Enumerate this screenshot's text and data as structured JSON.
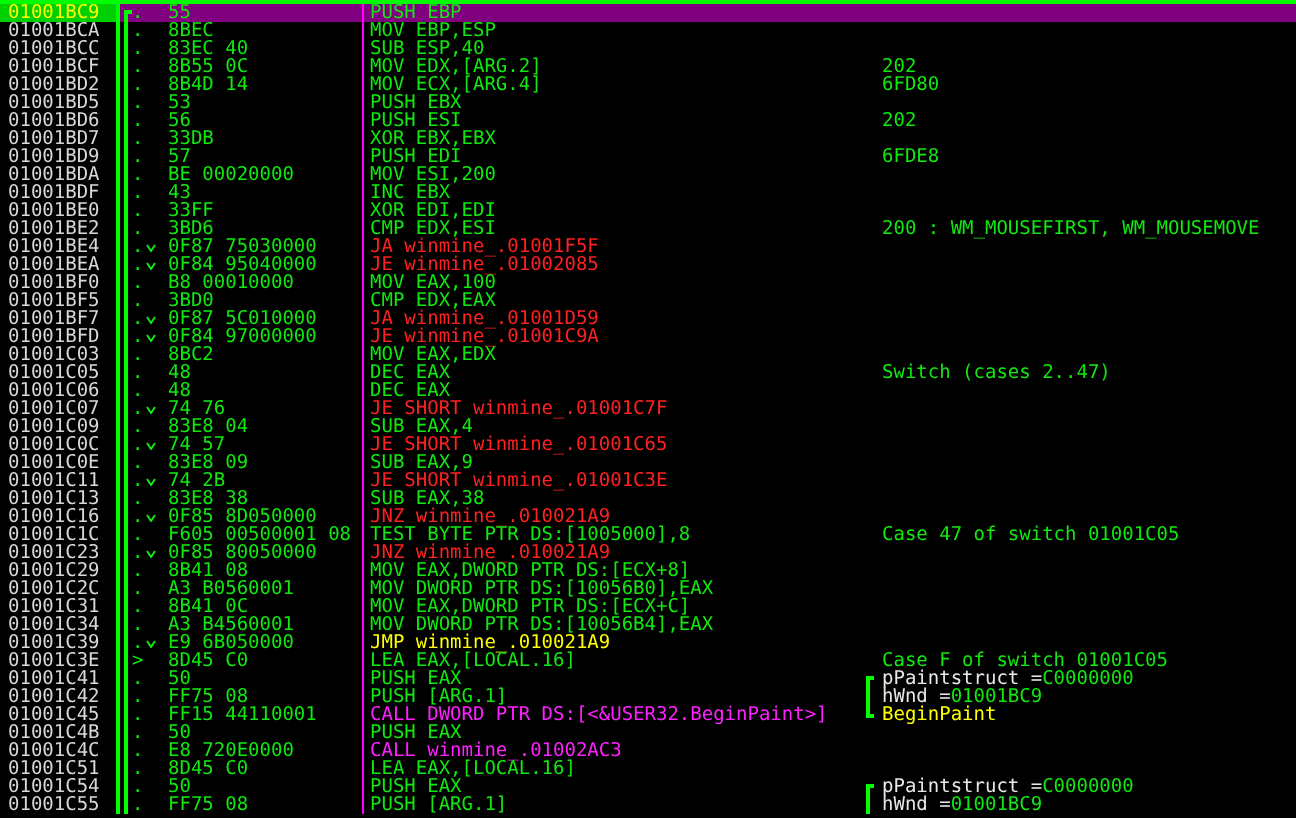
{
  "rows": [
    {
      "address": "01001BC9",
      "marker": ".",
      "jump": false,
      "hex": "55",
      "instruction": "PUSH EBP",
      "kind": "plain",
      "selected": true
    },
    {
      "address": "01001BCA",
      "marker": ".",
      "jump": false,
      "hex": "8BEC",
      "instruction": "MOV EBP,ESP",
      "kind": "plain",
      "selected": false
    },
    {
      "address": "01001BCC",
      "marker": ".",
      "jump": false,
      "hex": "83EC 40",
      "instruction": "SUB ESP,40",
      "kind": "plain",
      "selected": false
    },
    {
      "address": "01001BCF",
      "marker": ".",
      "jump": false,
      "hex": "8B55 0C",
      "instruction": "MOV EDX,[ARG.2]",
      "kind": "plain",
      "selected": false,
      "comment": {
        "kind": "note",
        "text": "202"
      }
    },
    {
      "address": "01001BD2",
      "marker": ".",
      "jump": false,
      "hex": "8B4D 14",
      "instruction": "MOV ECX,[ARG.4]",
      "kind": "plain",
      "selected": false,
      "comment": {
        "kind": "note",
        "text": "6FD80"
      }
    },
    {
      "address": "01001BD5",
      "marker": ".",
      "jump": false,
      "hex": "53",
      "instruction": "PUSH EBX",
      "kind": "plain",
      "selected": false
    },
    {
      "address": "01001BD6",
      "marker": ".",
      "jump": false,
      "hex": "56",
      "instruction": "PUSH ESI",
      "kind": "plain",
      "selected": false,
      "comment": {
        "kind": "note",
        "text": "202"
      }
    },
    {
      "address": "01001BD7",
      "marker": ".",
      "jump": false,
      "hex": "33DB",
      "instruction": "XOR EBX,EBX",
      "kind": "plain",
      "selected": false
    },
    {
      "address": "01001BD9",
      "marker": ".",
      "jump": false,
      "hex": "57",
      "instruction": "PUSH EDI",
      "kind": "plain",
      "selected": false,
      "comment": {
        "kind": "note",
        "text": "6FDE8"
      }
    },
    {
      "address": "01001BDA",
      "marker": ".",
      "jump": false,
      "hex": "BE 00020000",
      "instruction": "MOV ESI,200",
      "kind": "plain",
      "selected": false
    },
    {
      "address": "01001BDF",
      "marker": ".",
      "jump": false,
      "hex": "43",
      "instruction": "INC EBX",
      "kind": "plain",
      "selected": false
    },
    {
      "address": "01001BE0",
      "marker": ".",
      "jump": false,
      "hex": "33FF",
      "instruction": "XOR EDI,EDI",
      "kind": "plain",
      "selected": false
    },
    {
      "address": "01001BE2",
      "marker": ".",
      "jump": false,
      "hex": "3BD6",
      "instruction": "CMP EDX,ESI",
      "kind": "plain",
      "selected": false,
      "comment": {
        "kind": "note",
        "text": "200 : WM_MOUSEFIRST, WM_MOUSEMOVE"
      }
    },
    {
      "address": "01001BE4",
      "marker": ".",
      "jump": true,
      "hex": "0F87 75030000",
      "instruction": "JA winmine_.01001F5F",
      "kind": "branch",
      "selected": false
    },
    {
      "address": "01001BEA",
      "marker": ".",
      "jump": true,
      "hex": "0F84 95040000",
      "instruction": "JE winmine_.01002085",
      "kind": "branch",
      "selected": false
    },
    {
      "address": "01001BF0",
      "marker": ".",
      "jump": false,
      "hex": "B8 00010000",
      "instruction": "MOV EAX,100",
      "kind": "plain",
      "selected": false
    },
    {
      "address": "01001BF5",
      "marker": ".",
      "jump": false,
      "hex": "3BD0",
      "instruction": "CMP EDX,EAX",
      "kind": "plain",
      "selected": false
    },
    {
      "address": "01001BF7",
      "marker": ".",
      "jump": true,
      "hex": "0F87 5C010000",
      "instruction": "JA winmine_.01001D59",
      "kind": "branch",
      "selected": false
    },
    {
      "address": "01001BFD",
      "marker": ".",
      "jump": true,
      "hex": "0F84 97000000",
      "instruction": "JE winmine_.01001C9A",
      "kind": "branch",
      "selected": false
    },
    {
      "address": "01001C03",
      "marker": ".",
      "jump": false,
      "hex": "8BC2",
      "instruction": "MOV EAX,EDX",
      "kind": "plain",
      "selected": false
    },
    {
      "address": "01001C05",
      "marker": ".",
      "jump": false,
      "hex": "48",
      "instruction": "DEC EAX",
      "kind": "plain",
      "selected": false,
      "comment": {
        "kind": "note",
        "text": "Switch (cases 2..47)"
      }
    },
    {
      "address": "01001C06",
      "marker": ".",
      "jump": false,
      "hex": "48",
      "instruction": "DEC EAX",
      "kind": "plain",
      "selected": false
    },
    {
      "address": "01001C07",
      "marker": ".",
      "jump": true,
      "hex": "74 76",
      "instruction": "JE SHORT winmine_.01001C7F",
      "kind": "branch",
      "selected": false
    },
    {
      "address": "01001C09",
      "marker": ".",
      "jump": false,
      "hex": "83E8 04",
      "instruction": "SUB EAX,4",
      "kind": "plain",
      "selected": false
    },
    {
      "address": "01001C0C",
      "marker": ".",
      "jump": true,
      "hex": "74 57",
      "instruction": "JE SHORT winmine_.01001C65",
      "kind": "branch",
      "selected": false
    },
    {
      "address": "01001C0E",
      "marker": ".",
      "jump": false,
      "hex": "83E8 09",
      "instruction": "SUB EAX,9",
      "kind": "plain",
      "selected": false
    },
    {
      "address": "01001C11",
      "marker": ".",
      "jump": true,
      "hex": "74 2B",
      "instruction": "JE SHORT winmine_.01001C3E",
      "kind": "branch",
      "selected": false
    },
    {
      "address": "01001C13",
      "marker": ".",
      "jump": false,
      "hex": "83E8 38",
      "instruction": "SUB EAX,38",
      "kind": "plain",
      "selected": false
    },
    {
      "address": "01001C16",
      "marker": ".",
      "jump": true,
      "hex": "0F85 8D050000",
      "instruction": "JNZ winmine_.010021A9",
      "kind": "branch",
      "selected": false
    },
    {
      "address": "01001C1C",
      "marker": ".",
      "jump": false,
      "hex": "F605 00500001 08",
      "instruction": "TEST BYTE PTR DS:[1005000],8",
      "kind": "plain",
      "selected": false,
      "comment": {
        "kind": "note",
        "text": "Case 47 of switch 01001C05"
      }
    },
    {
      "address": "01001C23",
      "marker": ".",
      "jump": true,
      "hex": "0F85 80050000",
      "instruction": "JNZ winmine_.010021A9",
      "kind": "branch",
      "selected": false
    },
    {
      "address": "01001C29",
      "marker": ".",
      "jump": false,
      "hex": "8B41 08",
      "instruction": "MOV EAX,DWORD PTR DS:[ECX+8]",
      "kind": "plain",
      "selected": false
    },
    {
      "address": "01001C2C",
      "marker": ".",
      "jump": false,
      "hex": "A3 B0560001",
      "instruction": "MOV DWORD PTR DS:[10056B0],EAX",
      "kind": "plain",
      "selected": false
    },
    {
      "address": "01001C31",
      "marker": ".",
      "jump": false,
      "hex": "8B41 0C",
      "instruction": "MOV EAX,DWORD PTR DS:[ECX+C]",
      "kind": "plain",
      "selected": false
    },
    {
      "address": "01001C34",
      "marker": ".",
      "jump": false,
      "hex": "A3 B4560001",
      "instruction": "MOV DWORD PTR DS:[10056B4],EAX",
      "kind": "plain",
      "selected": false
    },
    {
      "address": "01001C39",
      "marker": ".",
      "jump": true,
      "hex": "E9 6B050000",
      "instruction": "JMP winmine_.010021A9",
      "kind": "jmp",
      "selected": false
    },
    {
      "address": "01001C3E",
      "marker": ">",
      "jump": false,
      "hex": "8D45 C0",
      "instruction": "LEA EAX,[LOCAL.16]",
      "kind": "plain",
      "selected": false,
      "comment": {
        "kind": "note",
        "text": "Case F of switch 01001C05"
      }
    },
    {
      "address": "01001C41",
      "marker": ".",
      "jump": false,
      "hex": "50",
      "instruction": "PUSH EAX",
      "kind": "plain",
      "selected": false,
      "comment": {
        "kind": "arg",
        "label": "pPaintstruct =",
        "value": "C0000000",
        "bracket_top": true,
        "bracket_bottom": false
      }
    },
    {
      "address": "01001C42",
      "marker": ".",
      "jump": false,
      "hex": "FF75 08",
      "instruction": "PUSH [ARG.1]",
      "kind": "plain",
      "selected": false,
      "comment": {
        "kind": "arg",
        "label": "hWnd =",
        "value": "01001BC9",
        "bracket_top": false,
        "bracket_bottom": false
      }
    },
    {
      "address": "01001C45",
      "marker": ".",
      "jump": false,
      "hex": "FF15 44110001",
      "instruction": "CALL DWORD PTR DS:[<&USER32.BeginPaint>]",
      "kind": "call",
      "selected": false,
      "comment": {
        "kind": "api",
        "text": "BeginPaint",
        "bracket_top": false,
        "bracket_bottom": true
      }
    },
    {
      "address": "01001C4B",
      "marker": ".",
      "jump": false,
      "hex": "50",
      "instruction": "PUSH EAX",
      "kind": "plain",
      "selected": false
    },
    {
      "address": "01001C4C",
      "marker": ".",
      "jump": false,
      "hex": "E8 720E0000",
      "instruction": "CALL winmine_.01002AC3",
      "kind": "call",
      "selected": false
    },
    {
      "address": "01001C51",
      "marker": ".",
      "jump": false,
      "hex": "8D45 C0",
      "instruction": "LEA EAX,[LOCAL.16]",
      "kind": "plain",
      "selected": false
    },
    {
      "address": "01001C54",
      "marker": ".",
      "jump": false,
      "hex": "50",
      "instruction": "PUSH EAX",
      "kind": "plain",
      "selected": false,
      "comment": {
        "kind": "arg",
        "label": "pPaintstruct =",
        "value": "C0000000",
        "bracket_top": true,
        "bracket_bottom": false
      }
    },
    {
      "address": "01001C55",
      "marker": ".",
      "jump": false,
      "hex": "FF75 08",
      "instruction": "PUSH [ARG.1]",
      "kind": "plain",
      "selected": false,
      "comment": {
        "kind": "arg",
        "label": "hWnd =",
        "value": "01001BC9",
        "bracket_top": false,
        "bracket_bottom": false
      }
    }
  ]
}
